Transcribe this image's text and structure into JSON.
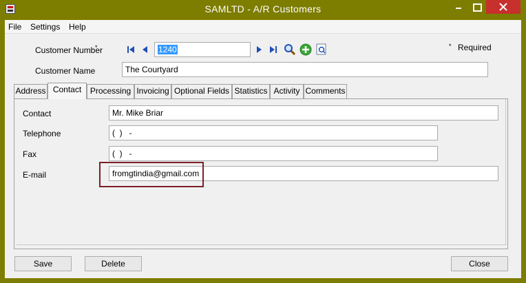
{
  "window": {
    "title": "SAMLTD - A/R Customers"
  },
  "menu": {
    "file": "File",
    "settings": "Settings",
    "help": "Help"
  },
  "header": {
    "customer_number_label": "Customer Number",
    "required_marker": "*",
    "customer_number_value": "1240",
    "required_legend": "Required",
    "customer_name_label": "Customer Name",
    "customer_name_value": "The Courtyard"
  },
  "tabs": [
    {
      "label": "Address"
    },
    {
      "label": "Contact"
    },
    {
      "label": "Processing"
    },
    {
      "label": "Invoicing"
    },
    {
      "label": "Optional Fields"
    },
    {
      "label": "Statistics"
    },
    {
      "label": "Activity"
    },
    {
      "label": "Comments"
    }
  ],
  "active_tab": "Contact",
  "contact": {
    "contact_label": "Contact",
    "contact_value": "Mr. Mike Briar",
    "telephone_label": "Telephone",
    "telephone_value": "(  )   -",
    "fax_label": "Fax",
    "fax_value": "(  )   -",
    "email_label": "E-mail",
    "email_value": "fromgtindia@gmail.com"
  },
  "buttons": {
    "save": "Save",
    "delete": "Delete",
    "close": "Close"
  },
  "colors": {
    "titlebar": "#7d7d00",
    "close_button": "#c7302c",
    "nav_arrows": "#1f4fb4",
    "selection": "#3399ff",
    "highlight_box": "#7a1f2a"
  },
  "icons": {
    "first": "first-record-icon",
    "previous": "previous-record-icon",
    "next": "next-record-icon",
    "last": "last-record-icon",
    "finder": "magnifier-icon",
    "new": "add-new-icon",
    "zoom": "zoom-icon"
  }
}
